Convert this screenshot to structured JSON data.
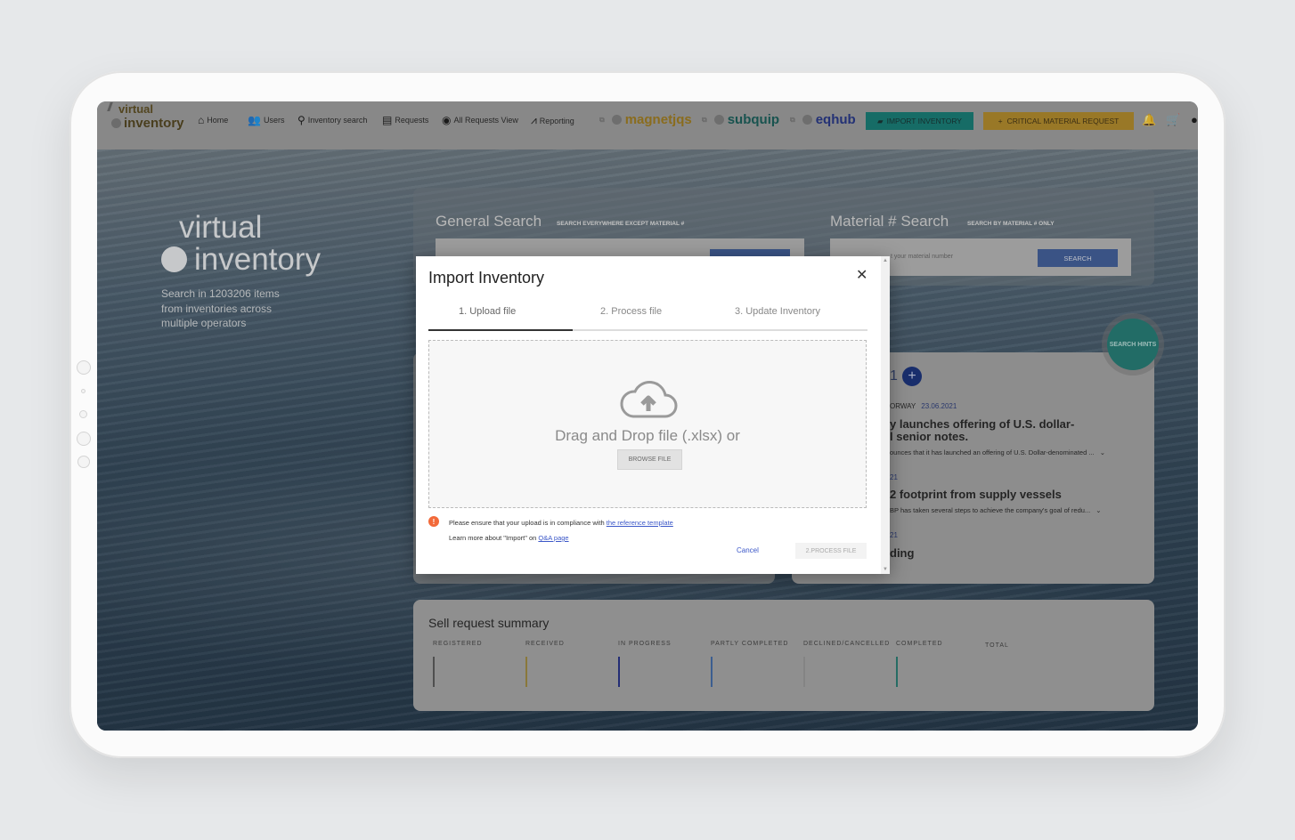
{
  "nav": {
    "logo_line1": "virtual",
    "logo_line2": "inventory",
    "items": [
      {
        "label": "Home",
        "icon": "home-icon"
      },
      {
        "label": "Users",
        "icon": "users-icon"
      },
      {
        "label": "Inventory search",
        "icon": "search-icon"
      },
      {
        "label": "Requests",
        "icon": "clipboard-icon"
      },
      {
        "label": "All Requests View",
        "icon": "eye-icon"
      },
      {
        "label": "Reporting",
        "icon": "trend-icon"
      }
    ],
    "brands": [
      {
        "name": "magnetjqs",
        "color": "#a07a15"
      },
      {
        "name": "subquip",
        "color": "#0f5a55"
      },
      {
        "name": "eqhub",
        "color": "#1d2f86"
      }
    ],
    "import_button": "IMPORT INVENTORY",
    "critical_button": "CRITICAL MATERIAL REQUEST"
  },
  "hero": {
    "line1": "virtual",
    "line2": "inventory",
    "description": "Search in 1203206 items from inventories across multiple operators"
  },
  "general_search": {
    "title": "General Search",
    "subtitle": "SEARCH EVERYWHERE EXCEPT MATERIAL #"
  },
  "material_search": {
    "title": "Material # Search",
    "subtitle": "SEARCH BY MATERIAL # ONLY",
    "placeholder": "t your material number",
    "button": "SEARCH"
  },
  "search_hints": "SEARCH HINTS",
  "news": {
    "count_fragment": "1",
    "item1_meta": "ORWAY",
    "item1_date": "23.06.2021",
    "item1_title_a": "y launches offering of U.S. dollar-",
    "item1_title_b": "l senior notes.",
    "item1_excerpt": "ounces that it has launched an offering of U.S. Dollar-denominated ...",
    "item2_date": "21",
    "item2_title": "2 footprint from supply vessels",
    "item2_excerpt": "BP has taken several steps to achieve the company's goal of redu...",
    "item3_date": "21",
    "item3_title": "ding"
  },
  "sell_summary": {
    "title": "Sell request summary",
    "columns": [
      {
        "label": "REGISTERED",
        "color": "#555555"
      },
      {
        "label": "RECEIVED",
        "color": "#a08a3a"
      },
      {
        "label": "IN PROGRESS",
        "color": "#1d2a86"
      },
      {
        "label": "PARTLY COMPLETED",
        "color": "#3d68a8"
      },
      {
        "label": "DECLINED/CANCELLED",
        "color": "#999999"
      },
      {
        "label": "COMPLETED",
        "color": "#1f7a70"
      },
      {
        "label": "TOTAL",
        "color": ""
      }
    ]
  },
  "modal": {
    "title": "Import Inventory",
    "steps": [
      "1. Upload file",
      "2. Process file",
      "3. Update Inventory"
    ],
    "drop_text": "Drag and Drop file (.xlsx) or",
    "browse_button": "BROWSE FILE",
    "notice_text": "Please ensure that your upload is in compliance with",
    "notice_link": "the reference template",
    "learn_text": "Learn more about \"Import\" on",
    "learn_link": "Q&A page",
    "cancel_button": "Cancel",
    "process_button": "2.PROCESS FILE"
  }
}
